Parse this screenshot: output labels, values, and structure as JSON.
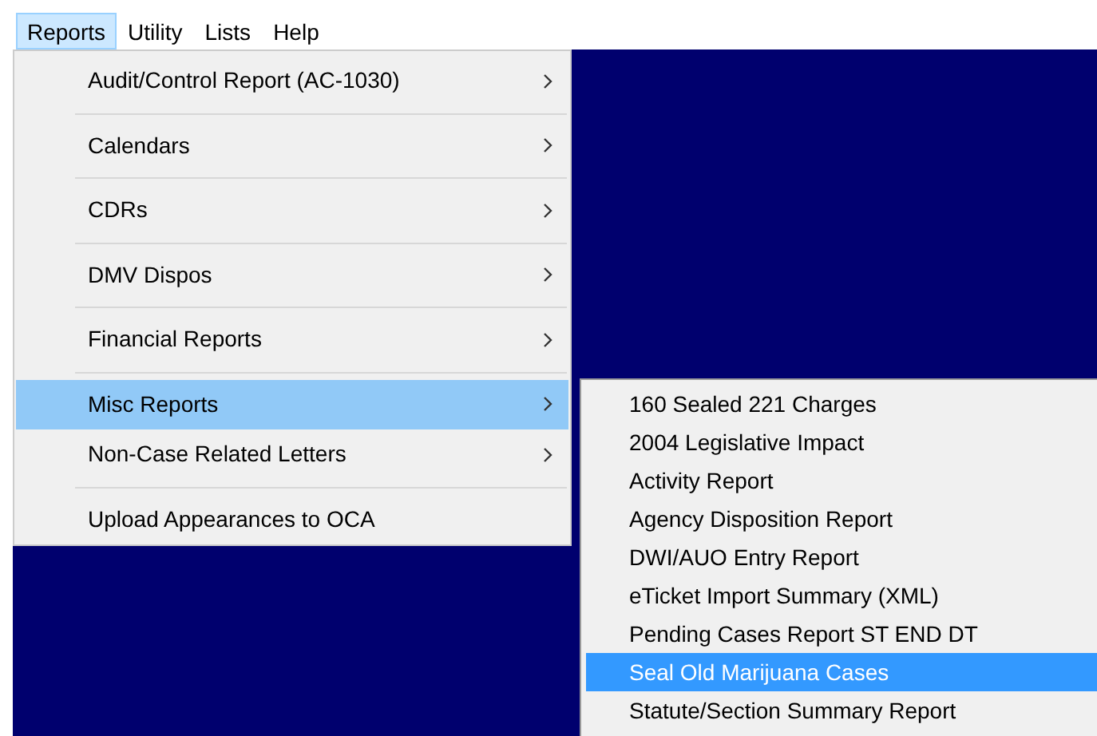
{
  "menu_bar": [
    {
      "label": "Reports",
      "selected": true
    },
    {
      "label": "Utility",
      "selected": false
    },
    {
      "label": "Lists",
      "selected": false
    },
    {
      "label": "Help",
      "selected": false
    }
  ],
  "dropdown": {
    "items": [
      {
        "label": "Audit/Control Report (AC-1030)",
        "selected": false,
        "has_submenu": true,
        "separator_after": true
      },
      {
        "label": "Calendars",
        "selected": false,
        "has_submenu": true,
        "separator_after": true
      },
      {
        "label": "CDRs",
        "selected": false,
        "has_submenu": true,
        "separator_after": true
      },
      {
        "label": "DMV Dispos",
        "selected": false,
        "has_submenu": true,
        "separator_after": true
      },
      {
        "label": "Financial Reports",
        "selected": false,
        "has_submenu": true,
        "separator_after": true
      },
      {
        "label": "Misc Reports",
        "selected": true,
        "has_submenu": true,
        "separator_after": false
      },
      {
        "label": "Non-Case Related Letters",
        "selected": false,
        "has_submenu": true,
        "separator_after": true
      },
      {
        "label": "Upload Appearances to OCA",
        "selected": false,
        "has_submenu": false,
        "separator_after": false
      }
    ]
  },
  "submenu": {
    "items": [
      {
        "label": "160 Sealed 221 Charges",
        "selected": false
      },
      {
        "label": "2004 Legislative Impact",
        "selected": false
      },
      {
        "label": "Activity Report",
        "selected": false
      },
      {
        "label": "Agency Disposition Report",
        "selected": false
      },
      {
        "label": "DWI/AUO Entry Report",
        "selected": false
      },
      {
        "label": "eTicket Import Summary  (XML)",
        "selected": false
      },
      {
        "label": "Pending Cases Report ST  END DT",
        "selected": false
      },
      {
        "label": "Seal Old Marijuana Cases",
        "selected": true
      },
      {
        "label": "Statute/Section Summary Report",
        "selected": false
      }
    ]
  }
}
